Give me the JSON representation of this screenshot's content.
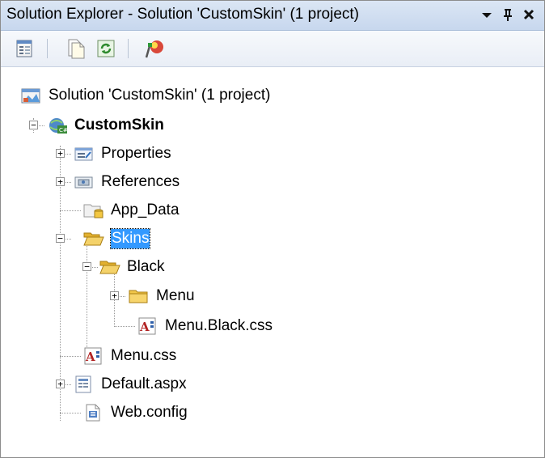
{
  "window": {
    "title": "Solution Explorer - Solution 'CustomSkin' (1 project)",
    "buttons": [
      "▾",
      "ᵻ",
      "✕"
    ]
  },
  "toolbar": {
    "items": [
      "properties-icon",
      "show-all-files-icon",
      "refresh-icon",
      "view-class-diagram-icon"
    ]
  },
  "tree": {
    "solution": "Solution 'CustomSkin' (1 project)",
    "project": "CustomSkin",
    "properties": "Properties",
    "references": "References",
    "app_data": "App_Data",
    "skins": "Skins",
    "black": "Black",
    "menu_folder": "Menu",
    "menu_black_css": "Menu.Black.css",
    "menu_css": "Menu.css",
    "default_aspx": "Default.aspx",
    "web_config": "Web.config"
  },
  "colors": {
    "selection": "#3399ff",
    "folder": "#f2c84b"
  }
}
